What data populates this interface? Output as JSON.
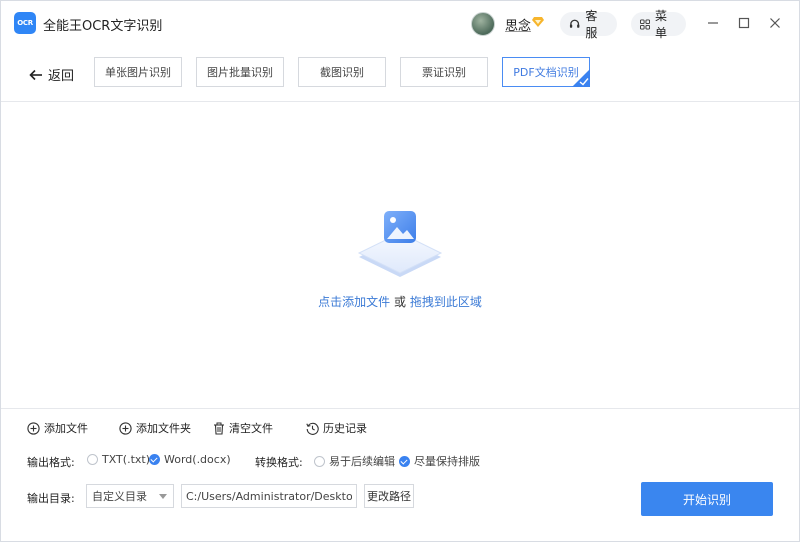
{
  "app": {
    "logo_text": "OCR",
    "title": "全能王OCR文字识别",
    "user_name": "思念",
    "service_label": "客服",
    "menu_label": "菜单"
  },
  "toolbar": {
    "back_label": "返回",
    "tabs": [
      {
        "label": "单张图片识别",
        "active": false
      },
      {
        "label": "图片批量识别",
        "active": false
      },
      {
        "label": "截图识别",
        "active": false
      },
      {
        "label": "票证识别",
        "active": false
      },
      {
        "label": "PDF文档识别",
        "active": true
      }
    ]
  },
  "dropzone": {
    "add_link": "点击添加文件",
    "or_text": " 或 ",
    "drag_link": "拖拽到此区域"
  },
  "actions": {
    "add_file": "添加文件",
    "add_folder": "添加文件夹",
    "clear_files": "清空文件",
    "history": "历史记录"
  },
  "output_format": {
    "label": "输出格式:",
    "options": [
      {
        "label": "TXT(.txt)",
        "checked": false
      },
      {
        "label": "Word(.docx)",
        "checked": true
      }
    ]
  },
  "convert_format": {
    "label": "转换格式:",
    "options": [
      {
        "label": "易于后续编辑",
        "checked": false
      },
      {
        "label": "尽量保持排版",
        "checked": true
      }
    ]
  },
  "output_dir": {
    "label": "输出目录:",
    "select_value": "自定义目录",
    "path_value": "C:/Users/Administrator/Desktop/OC",
    "change_button": "更改路径"
  },
  "start_button": "开始识别",
  "colors": {
    "accent": "#3a86ef",
    "link": "#3c7bd6",
    "logo": "#2f86f6"
  }
}
